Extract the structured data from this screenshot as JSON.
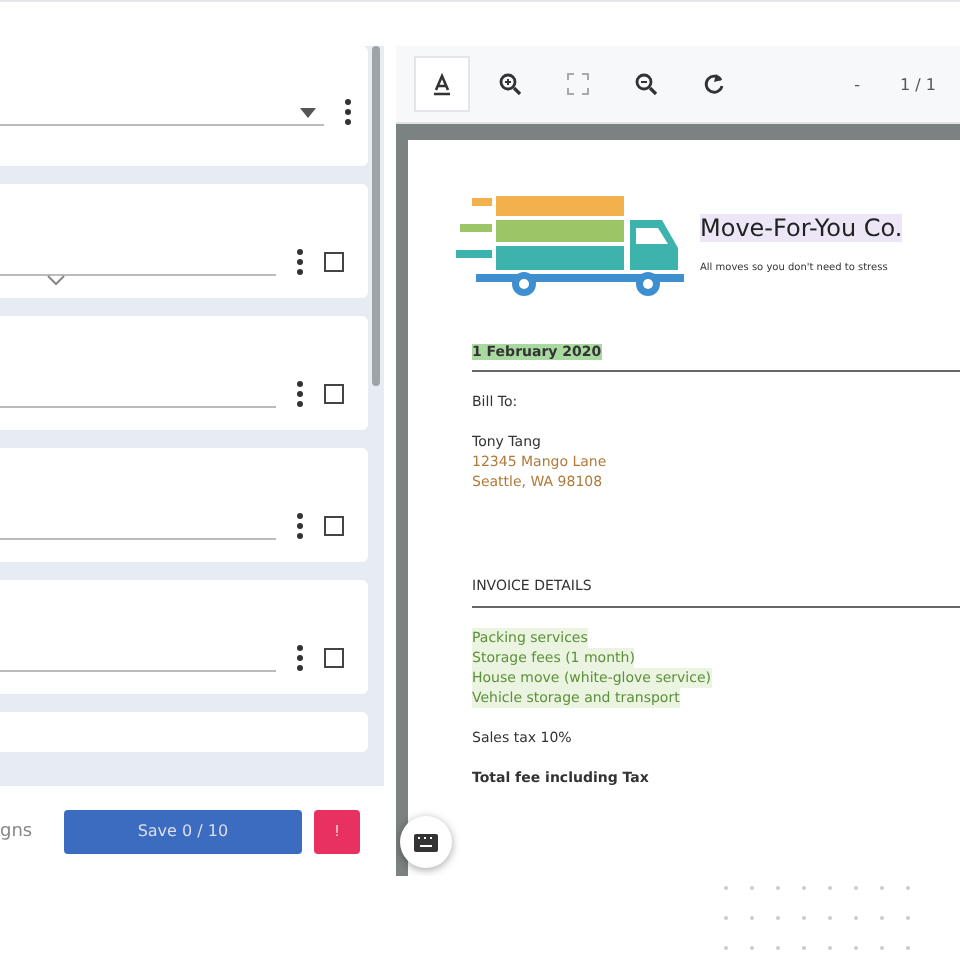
{
  "fields": [
    {
      "kind": "dropdown"
    },
    {
      "kind": "text",
      "checked": false,
      "expandable": true
    },
    {
      "kind": "text",
      "checked": false,
      "expandable": false
    },
    {
      "kind": "text",
      "checked": false,
      "expandable": false
    },
    {
      "kind": "text",
      "checked": false,
      "expandable": false
    }
  ],
  "footer": {
    "label": "gns",
    "primary_button": "Save 0 / 10",
    "danger_button": "!"
  },
  "viewer": {
    "tools": [
      {
        "kind": "text",
        "selected": true
      },
      {
        "kind": "zoom-in",
        "selected": false
      },
      {
        "kind": "fit",
        "selected": false
      },
      {
        "kind": "zoom-out",
        "selected": false
      },
      {
        "kind": "rotate",
        "selected": false
      }
    ],
    "page_prev": "-",
    "page_indicator": "1 / 1"
  },
  "invoice": {
    "company": "Move-For-You Co.",
    "tagline": "All moves so you don't need to stress",
    "date": "1 February 2020",
    "bill_to": "Bill To:",
    "name": "Tony Tang",
    "address": [
      "12345 Mango Lane",
      "Seattle, WA 98108"
    ],
    "details_heading": "INVOICE DETAILS",
    "items": [
      "Packing services",
      "Storage fees (1 month)",
      "House move (white-glove service)",
      "Vehicle storage and transport"
    ],
    "tax": "Sales tax 10%",
    "total": "Total fee including Tax"
  }
}
